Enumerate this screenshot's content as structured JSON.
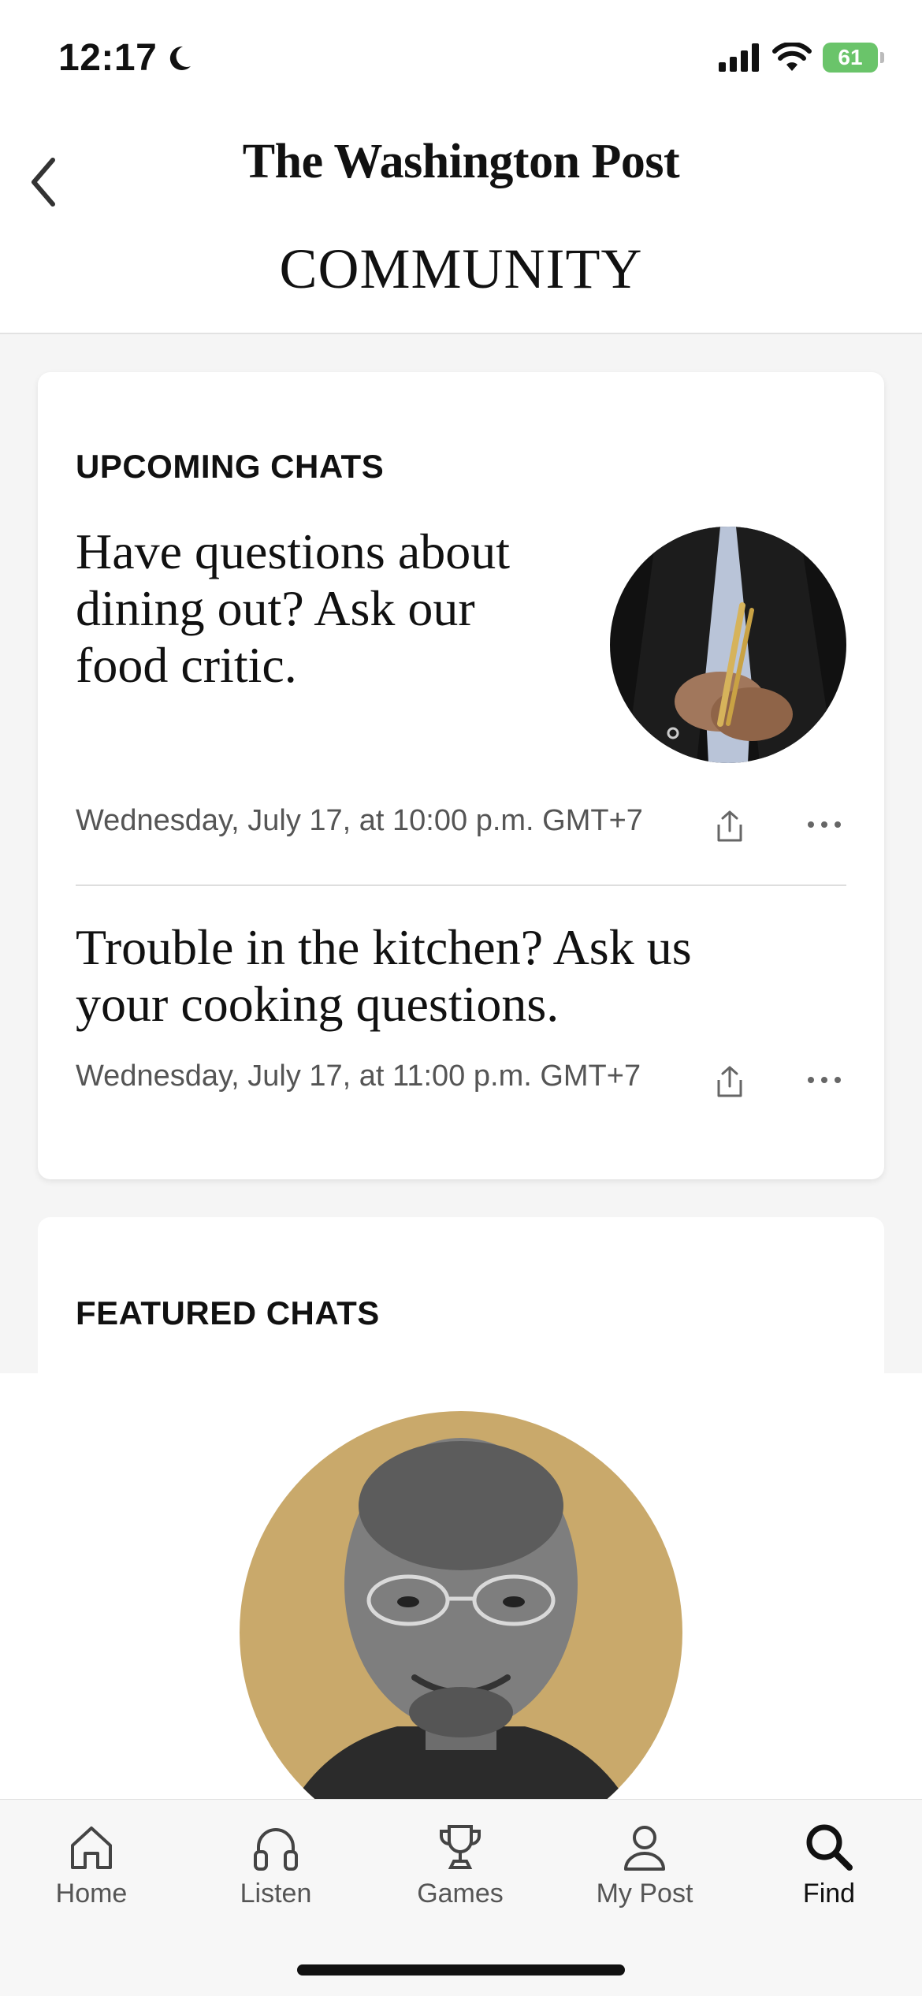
{
  "status": {
    "time": "12:17",
    "battery": "61"
  },
  "header": {
    "masthead": "The Washington Post",
    "title": "COMMUNITY"
  },
  "upcoming": {
    "label": "UPCOMING CHATS",
    "chats": [
      {
        "title_lines": [
          "Have questions about",
          "dining out? Ask our",
          "food critic."
        ],
        "meta": "Wednesday, July 17, at 10:00 p.m. GMT+7"
      },
      {
        "title_lines": [
          "Trouble in the kitchen? Ask us",
          "your cooking questions."
        ],
        "meta": "Wednesday, July 17, at 11:00 p.m. GMT+7"
      }
    ]
  },
  "featured": {
    "label": "FEATURED CHATS"
  },
  "tabs": [
    {
      "label": "Home",
      "icon": "home-icon"
    },
    {
      "label": "Listen",
      "icon": "headphones-icon"
    },
    {
      "label": "Games",
      "icon": "trophy-icon"
    },
    {
      "label": "My Post",
      "icon": "person-icon"
    },
    {
      "label": "Find",
      "icon": "search-icon",
      "active": true
    }
  ],
  "colors": {
    "accent_gold": "#c9a96b",
    "battery_green": "#6ac46a"
  }
}
